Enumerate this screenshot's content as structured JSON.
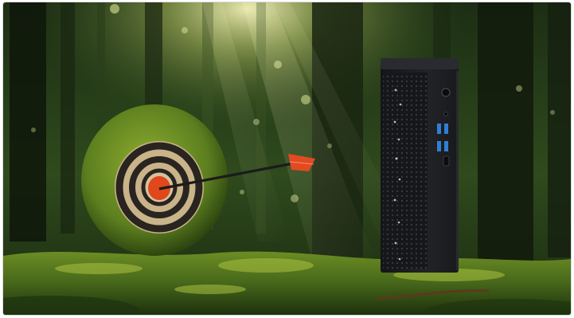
{
  "scene": {
    "subject": "mini-pc-tower-in-forest",
    "colors": {
      "forest_dark": "#0e1a0c",
      "forest_mid": "#2c4a1e",
      "moss": "#5d7f22",
      "moss_light": "#a3b93a",
      "sunlight": "#f2f0b0",
      "target_bullseye": "#e0471b",
      "target_ring": "#2a2420",
      "target_face": "#c9b48a",
      "arrow_fletching": "#e24a22",
      "case_body": "#1c1d20",
      "usb_port": "#2f7fd6"
    }
  }
}
